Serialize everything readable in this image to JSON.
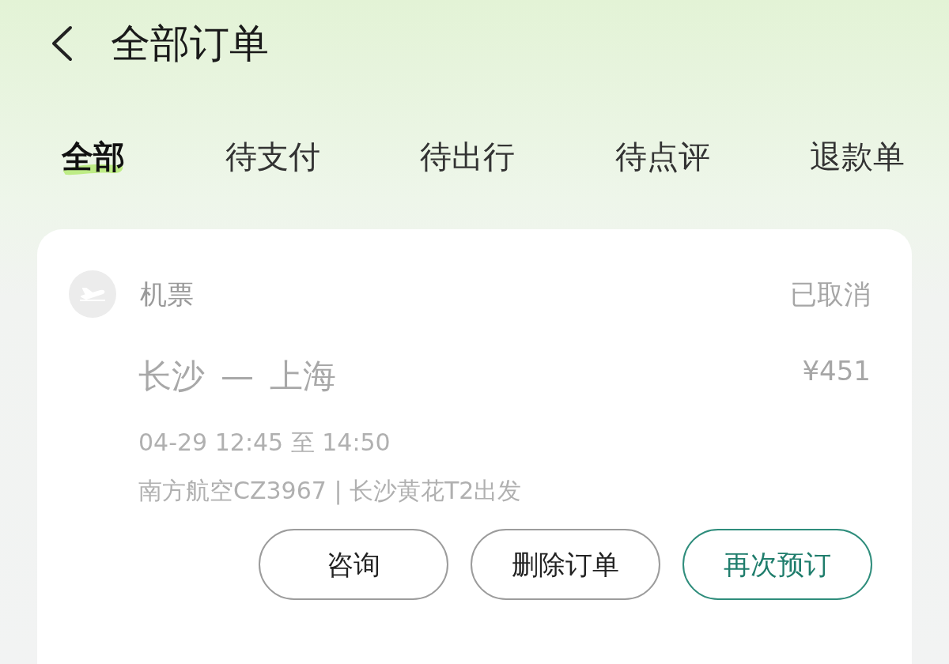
{
  "header": {
    "title": "全部订单"
  },
  "tabs": [
    {
      "label": "全部",
      "selected": true
    },
    {
      "label": "待支付",
      "selected": false
    },
    {
      "label": "待出行",
      "selected": false
    },
    {
      "label": "待点评",
      "selected": false
    },
    {
      "label": "退款单",
      "selected": false
    }
  ],
  "order": {
    "category": "机票",
    "status": "已取消",
    "route_from": "长沙",
    "route_separator": "—",
    "route_to": "上海",
    "price": "¥451",
    "time": "04-29 12:45 至 14:50",
    "details": "南方航空CZ3967 | 长沙黄花T2出发",
    "buttons": [
      {
        "label": "咨询",
        "kind": "plain"
      },
      {
        "label": "删除订单",
        "kind": "plain"
      },
      {
        "label": "再次预订",
        "kind": "primary"
      }
    ]
  }
}
